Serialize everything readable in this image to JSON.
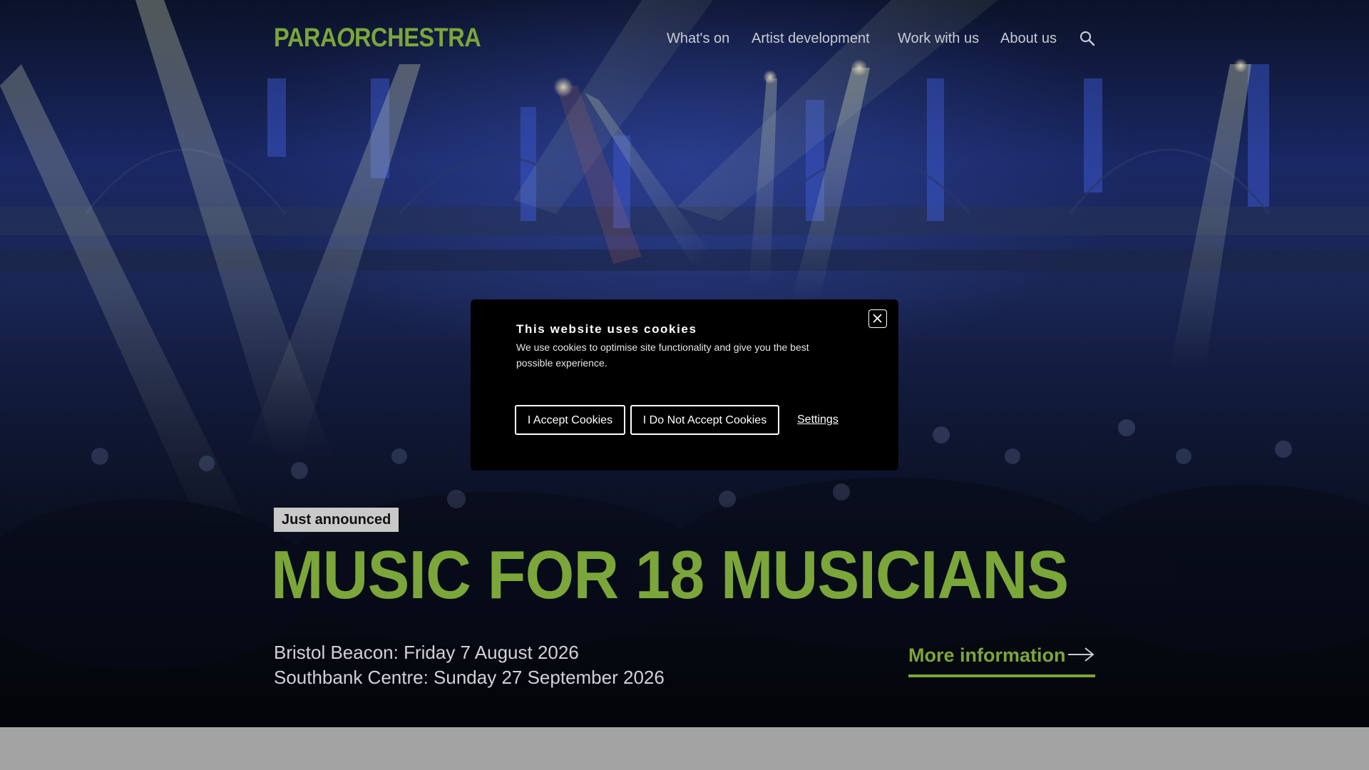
{
  "brand": {
    "logo_part1": "PARA",
    "logo_part2": "O",
    "logo_part3": "RCHESTRA",
    "accent_color": "#7ba63a"
  },
  "nav": {
    "items": [
      {
        "label": "What's on"
      },
      {
        "label": "Artist development"
      },
      {
        "label": "Work with us"
      },
      {
        "label": "About us"
      }
    ],
    "search_icon": "search-icon"
  },
  "hero": {
    "badge": "Just announced",
    "headline": "MUSIC FOR 18 MUSICIANS",
    "dates": [
      "Bristol Beacon: Friday 7 August 2026",
      "Southbank Centre: Sunday 27 September 2026"
    ],
    "more_label": "More information",
    "more_icon": "arrow-right-icon"
  },
  "cookie_banner": {
    "title": "This website uses cookies",
    "body": "We use cookies to optimise site functionality and give you the best possible experience.",
    "accept_label": "I Accept Cookies",
    "reject_label": "I Do Not Accept Cookies",
    "settings_label": "Settings",
    "close_icon": "close-icon"
  }
}
